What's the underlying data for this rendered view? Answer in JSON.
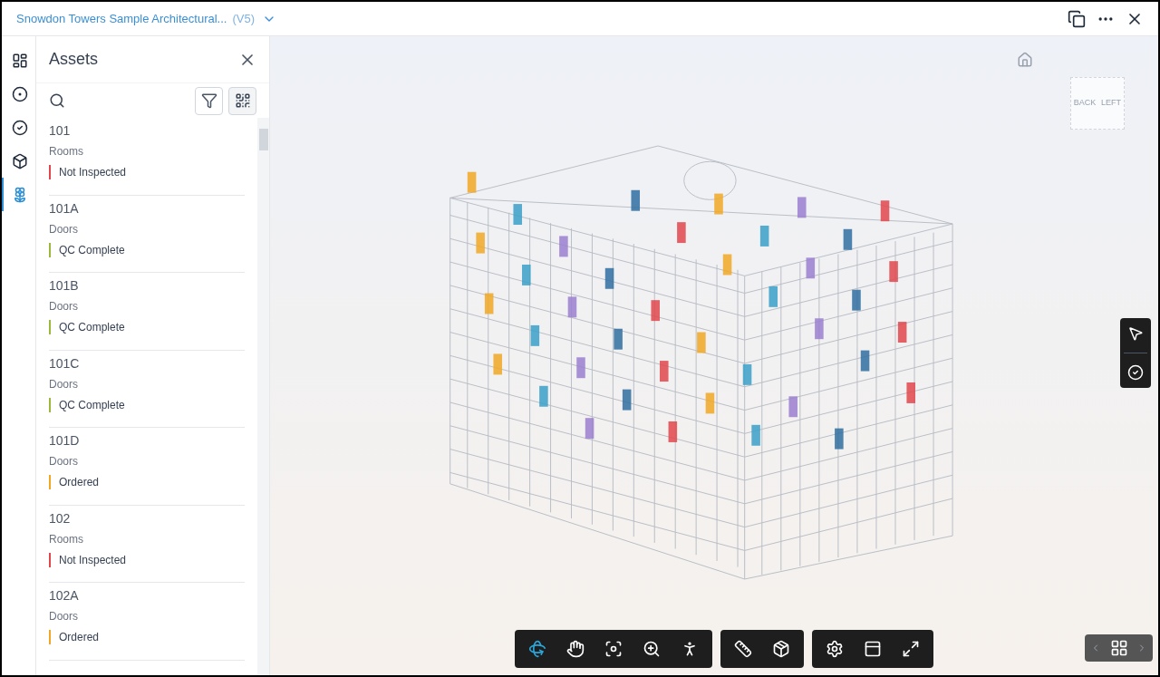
{
  "header": {
    "title": "Snowdon Towers Sample Architectural...",
    "version": "(V5)"
  },
  "sidebar_tabs": [
    {
      "selected": false
    },
    {
      "selected": false
    },
    {
      "selected": false
    },
    {
      "selected": false
    },
    {
      "selected": true
    }
  ],
  "panel": {
    "title": "Assets",
    "assets": [
      {
        "name": "101",
        "category": "Rooms",
        "status": "Not Inspected",
        "color": "#e0474c"
      },
      {
        "name": "101A",
        "category": "Doors",
        "status": "QC Complete",
        "color": "#9bb83b"
      },
      {
        "name": "101B",
        "category": "Doors",
        "status": "QC Complete",
        "color": "#9bb83b"
      },
      {
        "name": "101C",
        "category": "Doors",
        "status": "QC Complete",
        "color": "#9bb83b"
      },
      {
        "name": "101D",
        "category": "Doors",
        "status": "Ordered",
        "color": "#f0a824"
      },
      {
        "name": "102",
        "category": "Rooms",
        "status": "Not Inspected",
        "color": "#e0474c"
      },
      {
        "name": "102A",
        "category": "Doors",
        "status": "Ordered",
        "color": "#f0a824"
      }
    ]
  },
  "viewcube": {
    "faces": [
      "BACK",
      "LEFT"
    ]
  },
  "toolbar": [
    [
      {
        "selected": true
      },
      {
        "selected": false
      },
      {
        "selected": false
      },
      {
        "selected": false
      },
      {
        "selected": false
      }
    ],
    [
      {
        "selected": false
      },
      {
        "selected": false
      }
    ],
    [
      {
        "selected": false
      },
      {
        "selected": false
      },
      {
        "selected": false
      }
    ]
  ]
}
